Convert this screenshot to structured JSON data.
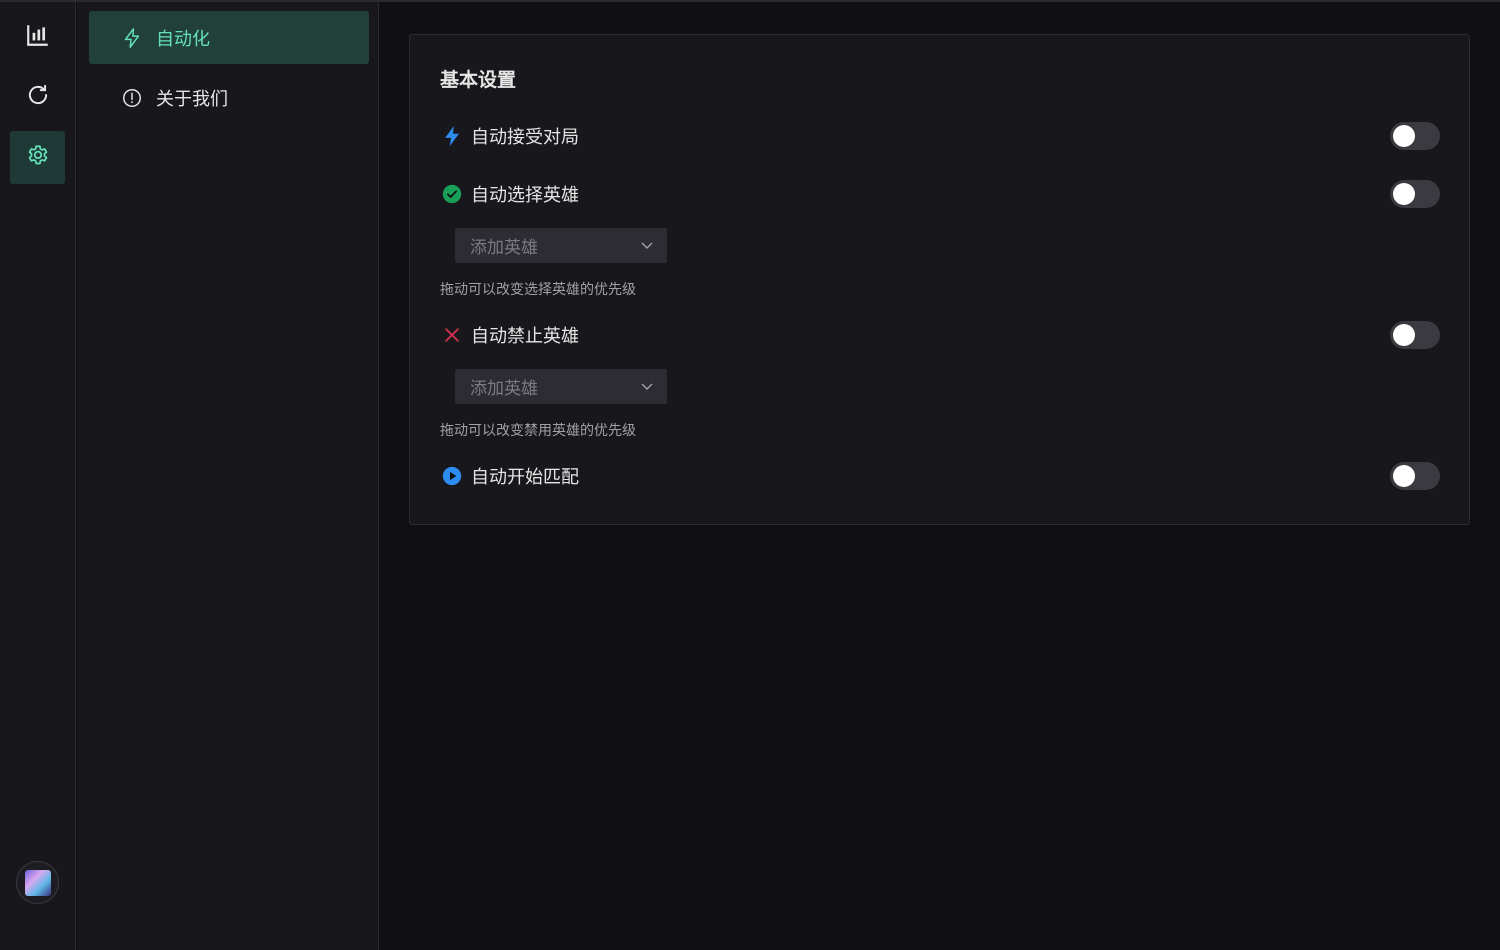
{
  "rail": {
    "items": [
      {
        "icon": "bar-chart-icon"
      },
      {
        "icon": "refresh-icon"
      },
      {
        "icon": "gear-icon",
        "active": true
      }
    ],
    "avatar_icon": "user-avatar"
  },
  "submenu": {
    "items": [
      {
        "label": "自动化",
        "icon": "lightning-icon",
        "active": true
      },
      {
        "label": "关于我们",
        "icon": "info-circle-icon",
        "active": false
      }
    ]
  },
  "main": {
    "card_title": "基本设置",
    "settings": [
      {
        "label": "自动接受对局",
        "icon": "lightning-icon",
        "icon_color": "#2d8cf0",
        "enabled": false
      },
      {
        "label": "自动选择英雄",
        "icon": "check-circle-icon",
        "icon_color": "#18a058",
        "enabled": false,
        "select_placeholder": "添加英雄",
        "hint": "拖动可以改变选择英雄的优先级"
      },
      {
        "label": "自动禁止英雄",
        "icon": "close-icon",
        "icon_color": "#d03050",
        "enabled": false,
        "select_placeholder": "添加英雄",
        "hint": "拖动可以改变禁用英雄的优先级"
      },
      {
        "label": "自动开始匹配",
        "icon": "play-circle-icon",
        "icon_color": "#2d8cf0",
        "enabled": false
      }
    ]
  },
  "colors": {
    "accent": "#63e2b7",
    "active_bg": "#22403a",
    "background": "#101014",
    "panel": "#18181c"
  }
}
